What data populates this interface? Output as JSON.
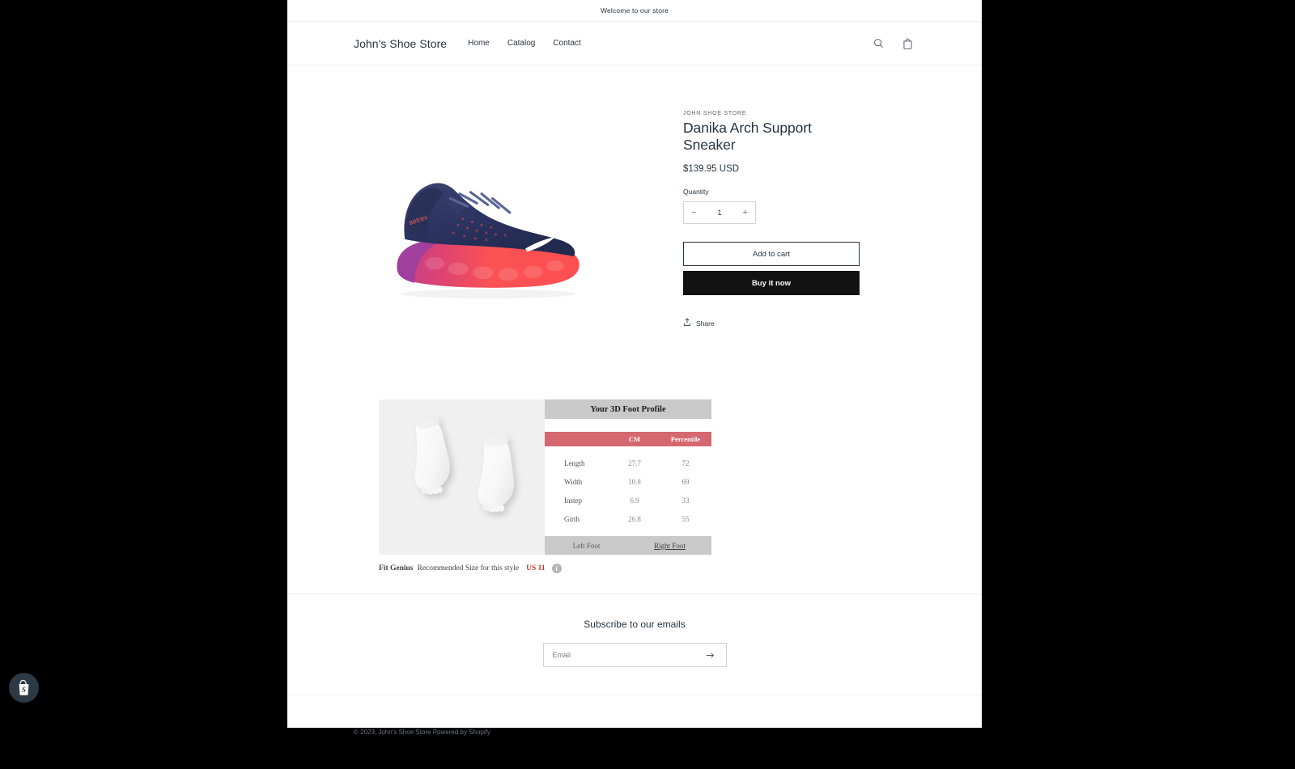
{
  "announcement": {
    "text": "Welcome to our store"
  },
  "header": {
    "brand": "John's Shoe Store",
    "nav": [
      {
        "label": "Home"
      },
      {
        "label": "Catalog"
      },
      {
        "label": "Contact"
      }
    ],
    "search_icon": "search-icon",
    "cart_icon": "cart-icon"
  },
  "product": {
    "vendor": "JOHN SHOE STORE",
    "title": "Danika Arch Support Sneaker",
    "price": "$139.95 USD",
    "quantity_label": "Quantity",
    "quantity_value": "1",
    "quantity_decrease": "−",
    "quantity_increase": "+",
    "add_to_cart": "Add to cart",
    "buy_it_now": "Buy it now",
    "share": "Share",
    "image_alt": "Navy blue running sneaker with coral sole",
    "colors": {
      "upper": "#2b3560",
      "midsole_purple": "#a martin",
      "outsole": "#fc4f52",
      "accent_purple": "#a0459b"
    }
  },
  "fit_genius": {
    "panel_title": "Your 3D Foot Profile",
    "columns": [
      "",
      "CM",
      "Percentile"
    ],
    "rows": [
      {
        "label": "Length",
        "cm": "27.7",
        "percentile": "72"
      },
      {
        "label": "Width",
        "cm": "10.8",
        "percentile": "69"
      },
      {
        "label": "Instep",
        "cm": "6.9",
        "percentile": "33"
      },
      {
        "label": "Girth",
        "cm": "26.8",
        "percentile": "55"
      }
    ],
    "tabs": [
      {
        "label": "Left Foot",
        "selected": false
      },
      {
        "label": "Right Foot",
        "selected": true
      }
    ],
    "caption_brand": "Fit Genius",
    "caption_text": "Recommended Size for this style",
    "recommended_size": "US 11",
    "info_icon_glyph": "i",
    "header_bar_color": "#c9c9c9",
    "table_header_color": "#d4676f",
    "size_color": "#c0392b"
  },
  "newsletter": {
    "title": "Subscribe to our emails",
    "placeholder": "Email",
    "value": "",
    "submit_icon": "arrow-right-icon"
  },
  "footer": {
    "copyright": "© 2023, John's Shoe Store Powered by Shopify",
    "badge_icon": "shopify-logo"
  }
}
